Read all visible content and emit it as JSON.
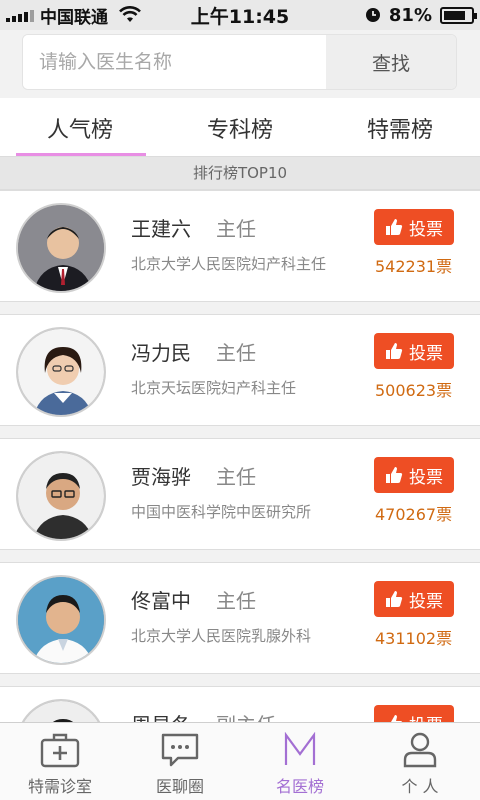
{
  "status_bar": {
    "carrier": "中国联通",
    "time": "上午11:45",
    "battery": "81%",
    "battery_level": 0.81
  },
  "search": {
    "placeholder": "请输入医生名称",
    "button": "查找"
  },
  "tabs": [
    {
      "label": "人气榜",
      "active": true
    },
    {
      "label": "专科榜",
      "active": false
    },
    {
      "label": "特需榜",
      "active": false
    }
  ],
  "ranking_header": "排行榜TOP10",
  "vote_label": "投票",
  "doctors": [
    {
      "name": "王建六",
      "title": "主任",
      "hospital": "北京大学人民医院妇产科主任",
      "votes": "542231票"
    },
    {
      "name": "冯力民",
      "title": "主任",
      "hospital": "北京天坛医院妇产科主任",
      "votes": "500623票"
    },
    {
      "name": "贾海骅",
      "title": "主任",
      "hospital": "中国中医科学院中医研究所",
      "votes": "470267票"
    },
    {
      "name": "佟富中",
      "title": "主任",
      "hospital": "北京大学人民医院乳腺外科",
      "votes": "431102票"
    },
    {
      "name": "周易冬",
      "title": "副主任",
      "hospital": "",
      "votes": ""
    }
  ],
  "bottom_nav": [
    {
      "label": "特需诊室",
      "icon": "medical-kit-icon",
      "active": false
    },
    {
      "label": "医聊圈",
      "icon": "chat-bubble-icon",
      "active": false
    },
    {
      "label": "名医榜",
      "icon": "m-ranking-icon",
      "active": true
    },
    {
      "label": "个 人",
      "icon": "person-icon",
      "active": false
    }
  ],
  "colors": {
    "accent": "#e88ee4",
    "vote_button": "#ee4e24",
    "vote_count": "#d06a12",
    "nav_active": "#a36fd3"
  }
}
